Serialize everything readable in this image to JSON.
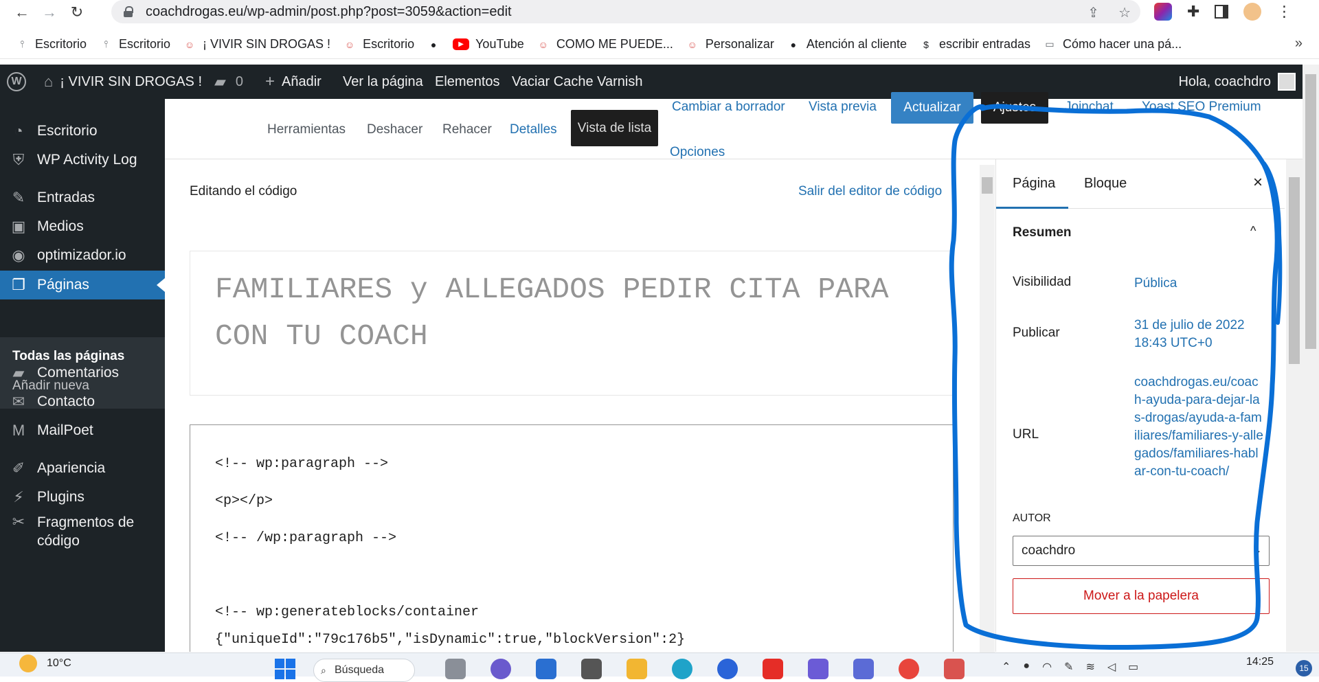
{
  "browser": {
    "url": "coachdrogas.eu/wp-admin/post.php?post=3059&action=edit",
    "bookmarks": [
      {
        "label": "Escritorio",
        "icon": "wp-pin-icon"
      },
      {
        "label": "Escritorio",
        "icon": "wp-pin-icon"
      },
      {
        "label": "¡ VIVIR SIN DROGAS !",
        "icon": "site-favicon-icon"
      },
      {
        "label": "Escritorio",
        "icon": "site-favicon-icon"
      },
      {
        "label": "",
        "icon": "globe-icon"
      },
      {
        "label": "YouTube",
        "icon": "youtube-icon"
      },
      {
        "label": "COMO ME PUEDE...",
        "icon": "site-favicon-icon"
      },
      {
        "label": "Personalizar",
        "icon": "site-favicon-icon"
      },
      {
        "label": "Atención al cliente",
        "icon": "globe-icon"
      },
      {
        "label": "escribir entradas",
        "icon": "dollar-icon"
      },
      {
        "label": "Cómo hacer una pá...",
        "icon": "laptop-icon"
      }
    ],
    "more_bookmarks": "»"
  },
  "adminbar": {
    "site_name": "¡ VIVIR SIN DROGAS !",
    "comments_count": "0",
    "add_new": "Añadir",
    "view_page": "Ver la página",
    "elements": "Elementos",
    "varnish": "Vaciar Cache Varnish",
    "howdy": "Hola, coachdro"
  },
  "sidebar": {
    "items": [
      {
        "label": "Escritorio",
        "icon": "dashboard-icon"
      },
      {
        "label": "WP Activity Log",
        "icon": "shield-icon"
      },
      {
        "label": "Entradas",
        "icon": "pin-icon"
      },
      {
        "label": "Medios",
        "icon": "media-icon"
      },
      {
        "label": "optimizador.io",
        "icon": "gauge-icon"
      },
      {
        "label": "Páginas",
        "icon": "pages-icon"
      },
      {
        "label": "Comentarios",
        "icon": "comment-icon"
      },
      {
        "label": "Contacto",
        "icon": "mail-icon"
      },
      {
        "label": "MailPoet",
        "icon": "mailpoet-icon"
      },
      {
        "label": "Apariencia",
        "icon": "brush-icon"
      },
      {
        "label": "Plugins",
        "icon": "plugin-icon"
      },
      {
        "label": "Fragmentos de código",
        "icon": "scissors-icon"
      }
    ],
    "submenu": {
      "all_pages": "Todas las páginas",
      "add_new": "Añadir nueva"
    }
  },
  "editor_header": {
    "tools": "Herramientas",
    "undo": "Deshacer",
    "redo": "Rehacer",
    "details": "Detalles",
    "list_view": "Vista de lista",
    "switch_draft": "Cambiar a borrador",
    "preview": "Vista previa",
    "update": "Actualizar",
    "settings": "Ajustes",
    "joinchat": "Joinchat",
    "yoast": "Yoast SEO Premium",
    "options": "Opciones"
  },
  "code_editor": {
    "heading": "Editando el código",
    "exit": "Salir del editor de código",
    "title_line1": "FAMILIARES y ALLEGADOS PEDIR CITA PARA",
    "title_line2": "CON TU COACH",
    "lines": [
      "<!-- wp:paragraph -->",
      "<p></p>",
      "<!-- /wp:paragraph -->",
      "",
      "<!-- wp:generateblocks/container",
      "{\"uniqueId\":\"79c176b5\",\"isDynamic\":true,\"blockVersion\":2}"
    ]
  },
  "settings": {
    "tab_page": "Página",
    "tab_block": "Bloque",
    "close": "×",
    "summary": "Resumen",
    "visibility_label": "Visibilidad",
    "visibility_value": "Pública",
    "publish_label": "Publicar",
    "publish_value": "31 de julio de 2022 18:43 UTC+0",
    "url_label": "URL",
    "url_value": "coachdrogas.eu/coach-ayuda-para-dejar-las-drogas/ayuda-a-familiares/familiares-y-allegados/familiares-hablar-con-tu-coach/",
    "author_label": "AUTOR",
    "author_value": "coachdro",
    "trash": "Mover a la papelera"
  },
  "taskbar": {
    "temperature": "10°C",
    "search": "Búsqueda",
    "time": "14:25",
    "notifications": "15"
  },
  "colors": {
    "wp_dark": "#1d2327",
    "wp_blue": "#2271b1",
    "update_blue": "#3582c4",
    "annotation": "#0a6fd6",
    "danger": "#cc1818"
  }
}
